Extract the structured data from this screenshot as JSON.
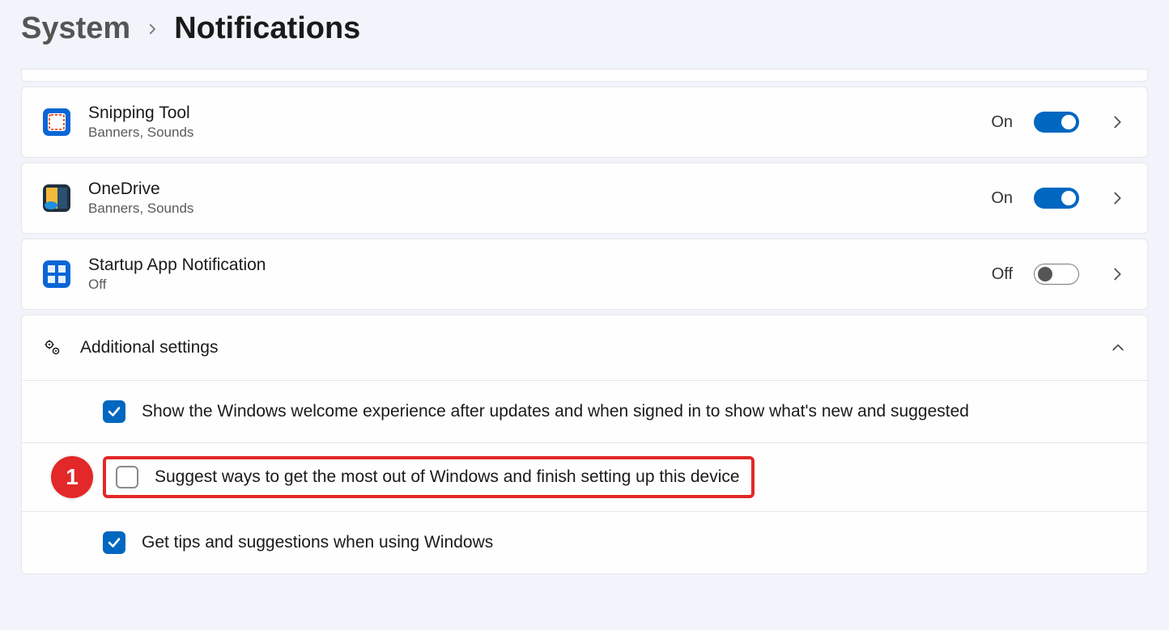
{
  "breadcrumb": {
    "parent": "System",
    "current": "Notifications"
  },
  "apps": [
    {
      "title": "Snipping Tool",
      "sub": "Banners, Sounds",
      "state_label": "On",
      "on": true,
      "icon": "snipping"
    },
    {
      "title": "OneDrive",
      "sub": "Banners, Sounds",
      "state_label": "On",
      "on": true,
      "icon": "onedrive"
    },
    {
      "title": "Startup App Notification",
      "sub": "Off",
      "state_label": "Off",
      "on": false,
      "icon": "startup"
    }
  ],
  "additional": {
    "header": "Additional settings",
    "options": [
      {
        "label": "Show the Windows welcome experience after updates and when signed in to show what's new and suggested",
        "checked": true,
        "highlight": false
      },
      {
        "label": "Suggest ways to get the most out of Windows and finish setting up this device",
        "checked": false,
        "highlight": true,
        "annotation": "1"
      },
      {
        "label": "Get tips and suggestions when using Windows",
        "checked": true,
        "highlight": false
      }
    ]
  }
}
